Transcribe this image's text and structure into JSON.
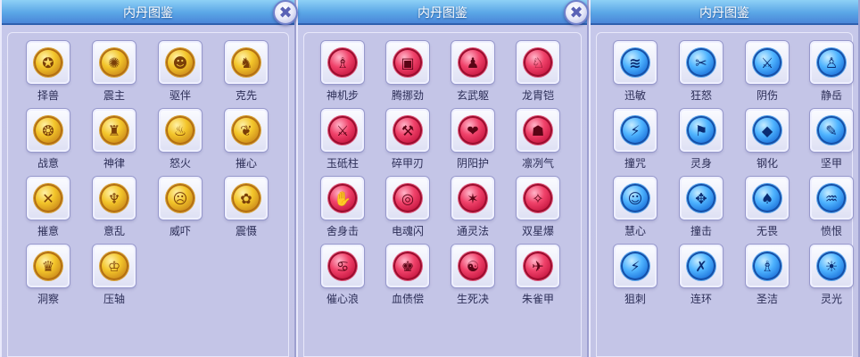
{
  "panels": [
    {
      "title": "内丹图鉴",
      "items": [
        {
          "name": "择兽",
          "glyph": "✪"
        },
        {
          "name": "震主",
          "glyph": "✺"
        },
        {
          "name": "驱伴",
          "glyph": "☻"
        },
        {
          "name": "克先",
          "glyph": "♞"
        },
        {
          "name": "战意",
          "glyph": "❂"
        },
        {
          "name": "神律",
          "glyph": "♜"
        },
        {
          "name": "怒火",
          "glyph": "♨"
        },
        {
          "name": "摧心",
          "glyph": "❦"
        },
        {
          "name": "摧意",
          "glyph": "✕"
        },
        {
          "name": "意乱",
          "glyph": "♆"
        },
        {
          "name": "威吓",
          "glyph": "☹"
        },
        {
          "name": "震慑",
          "glyph": "✿"
        },
        {
          "name": "洞察",
          "glyph": "♛"
        },
        {
          "name": "压轴",
          "glyph": "♔"
        }
      ]
    },
    {
      "title": "内丹图鉴",
      "items": [
        {
          "name": "神机步",
          "glyph": "♗"
        },
        {
          "name": "腾挪劲",
          "glyph": "▣"
        },
        {
          "name": "玄武躯",
          "glyph": "♟"
        },
        {
          "name": "龙胄铠",
          "glyph": "♘"
        },
        {
          "name": "玉砥柱",
          "glyph": "⚔"
        },
        {
          "name": "碎甲刃",
          "glyph": "⚒"
        },
        {
          "name": "阴阳护",
          "glyph": "❤"
        },
        {
          "name": "凛冽气",
          "glyph": "☗"
        },
        {
          "name": "舍身击",
          "glyph": "✋"
        },
        {
          "name": "电魂闪",
          "glyph": "◎"
        },
        {
          "name": "通灵法",
          "glyph": "✶"
        },
        {
          "name": "双星爆",
          "glyph": "✧"
        },
        {
          "name": "催心浪",
          "glyph": "♋"
        },
        {
          "name": "血债偿",
          "glyph": "♚"
        },
        {
          "name": "生死决",
          "glyph": "☯"
        },
        {
          "name": "朱雀甲",
          "glyph": "✈"
        }
      ]
    },
    {
      "title": "内丹图鉴",
      "items": [
        {
          "name": "迅敏",
          "glyph": "≋"
        },
        {
          "name": "狂怒",
          "glyph": "✂"
        },
        {
          "name": "阴伤",
          "glyph": "⚔"
        },
        {
          "name": "静岳",
          "glyph": "♙"
        },
        {
          "name": "撞咒",
          "glyph": "⚡"
        },
        {
          "name": "灵身",
          "glyph": "⚑"
        },
        {
          "name": "钢化",
          "glyph": "◆"
        },
        {
          "name": "坚甲",
          "glyph": "✎"
        },
        {
          "name": "慧心",
          "glyph": "☺"
        },
        {
          "name": "撞击",
          "glyph": "✥"
        },
        {
          "name": "无畏",
          "glyph": "♠"
        },
        {
          "name": "愤恨",
          "glyph": "♒"
        },
        {
          "name": "狙刺",
          "glyph": "⚡"
        },
        {
          "name": "连环",
          "glyph": "✗"
        },
        {
          "name": "圣洁",
          "glyph": "♗"
        },
        {
          "name": "灵光",
          "glyph": "☀"
        }
      ]
    }
  ],
  "close_glyph": "✖",
  "colors": {
    "gold": "#f3c52a",
    "red": "#f0426a",
    "blue": "#4fb4ff"
  }
}
